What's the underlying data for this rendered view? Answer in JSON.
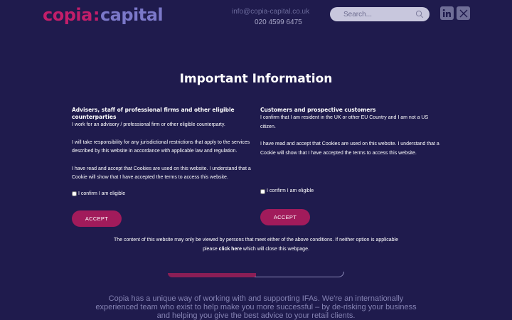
{
  "header": {
    "logo_part1": "copia",
    "logo_colon": ":",
    "logo_part2": "capital",
    "email": "info@copia-capital.co.uk",
    "phone": "020 4599 6475",
    "search_placeholder": "Search...",
    "social_icons": [
      "linkedin-icon",
      "x-icon"
    ]
  },
  "modal": {
    "title": "Important Information",
    "advisers": {
      "heading": "Advisers, staff of professional firms and other eligible counterparties",
      "paragraphs": [
        "I work for an advisory / professional firm or other eligible counterparty.",
        "I will take responsibility for any jurisdictional restrictions that apply to the services described by this website in accordance with applicable law and regulation.",
        "I have read and accept that Cookies are used on this website.  I understand that a Cookie will show that I have accepted the terms to access this website."
      ],
      "confirm_label": "I confirm I am eligible",
      "accept_label": "ACCEPT"
    },
    "customers": {
      "heading": "Customers and prospective customers",
      "paragraphs": [
        "I confirm that I am resident in the UK or other EU Country and I am not a US citizen.",
        "I have read and accept that Cookies are used on this website.  I understand that a Cookie will show that I have accepted the terms to access this website."
      ],
      "confirm_label": "I confirm I am eligible",
      "accept_label": "ACCEPT"
    },
    "footnote_before": "The content of this website may only be viewed by persons that meet either of the above conditions.  If neither option is applicable please ",
    "footnote_link": "click here",
    "footnote_after": " which will close this webpage."
  },
  "intro_text": "Copia has a unique way of working with and supporting IFAs. We're an internationally experienced team who exist to help make you more successful – by de-risking your business and helping you give the best advice to your retail clients.",
  "colors": {
    "background": "#1f1b4d",
    "accent": "#a11b5b",
    "logo_pink": "#c21e6a",
    "logo_purple": "#7b78c9"
  }
}
